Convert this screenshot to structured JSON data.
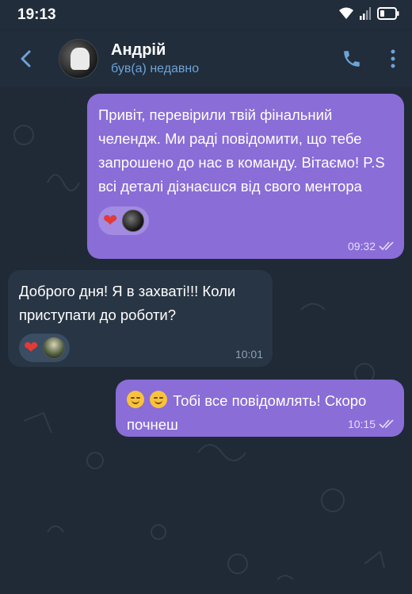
{
  "status_bar": {
    "time": "19:13"
  },
  "header": {
    "contact_name": "Андрій",
    "contact_status": "був(а) недавно"
  },
  "messages": [
    {
      "direction": "out",
      "text": "Привіт, перевірили твій фінальний челендж. Ми раді повідомити, що тебе запрошено до нас в команду. Вітаємо! P.S всі деталі дізнаєшся від свого ментора",
      "time": "09:32",
      "reactions": [
        "heart"
      ]
    },
    {
      "direction": "in",
      "text": "Доброго дня! Я в захваті!!! Коли приступати до роботи?",
      "time": "10:01",
      "reactions": [
        "heart"
      ]
    },
    {
      "direction": "out",
      "text": "Тобі все повідомлять! Скоро почнеш",
      "emojis": [
        "smiling-face-icon",
        "smiling-face-icon"
      ],
      "time": "10:15"
    }
  ],
  "colors": {
    "header_bg": "#212d3b",
    "chat_bg": "#1f2a36",
    "outgoing_bubble": "#8a6dd6",
    "incoming_bubble": "#283544",
    "accent": "#6da3d8"
  }
}
